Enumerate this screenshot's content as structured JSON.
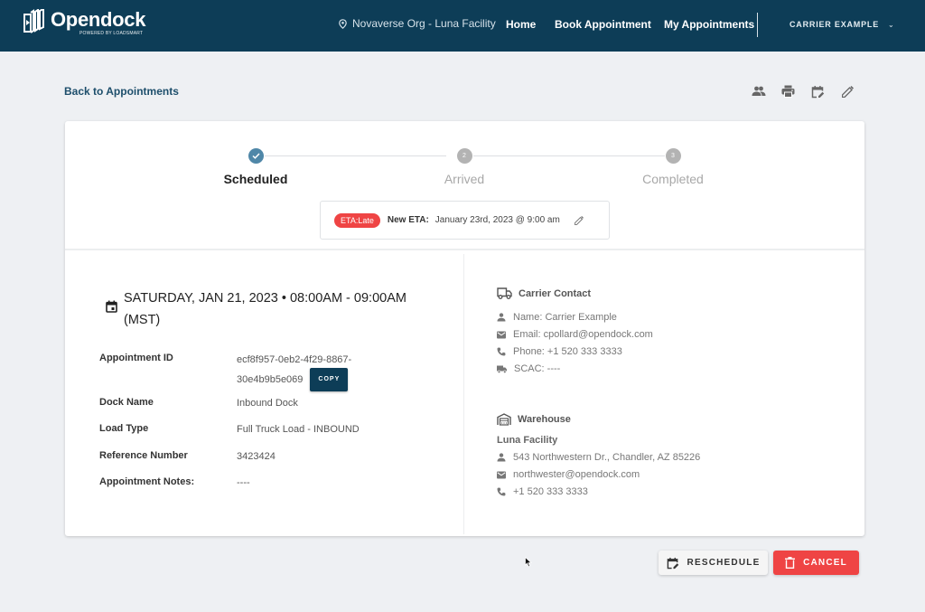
{
  "header": {
    "brand": {
      "name": "Opendock",
      "tagline": "POWERED BY LOADSMART"
    },
    "facility": {
      "icon": "location-pin-icon",
      "label": "Novaverse Org - Luna Facility"
    },
    "nav": [
      {
        "label": "Home"
      },
      {
        "label": "Book Appointment"
      },
      {
        "label": "My Appointments"
      }
    ],
    "user_menu": {
      "label": "CARRIER EXAMPLE",
      "icon": "chevron-down-icon"
    }
  },
  "page": {
    "back_link": "Back to Appointments",
    "toolbar": [
      {
        "icon": "users-icon",
        "action": "Manage users"
      },
      {
        "icon": "printer-icon",
        "action": "Print"
      },
      {
        "icon": "calendar-edit-icon",
        "action": "Reschedule"
      },
      {
        "icon": "pencil-icon",
        "action": "Edit"
      }
    ]
  },
  "stepper": {
    "steps": [
      {
        "number": "1",
        "label": "Scheduled",
        "state": "complete"
      },
      {
        "number": "2",
        "label": "Arrived",
        "state": "pending"
      },
      {
        "number": "3",
        "label": "Completed",
        "state": "pending"
      }
    ],
    "colors": {
      "complete": "#4f87a8",
      "pending": "#b3b3b3"
    }
  },
  "eta": {
    "chip": "ETA:Late",
    "label": "New ETA:",
    "value": "January 23rd, 2023 @ 9:00 am"
  },
  "appointment": {
    "date_line": "SATURDAY, JAN 21, 2023  •  08:00AM - 09:00AM (MST)",
    "details": [
      {
        "label": "Appointment ID",
        "value_line1": "ecf8f957-0eb2-4f29-8867-",
        "value_line2": "30e4b9b5e069"
      },
      {
        "label": "Dock Name",
        "value": "Inbound Dock"
      },
      {
        "label": "Load Type",
        "value": "Full Truck Load - INBOUND"
      },
      {
        "label": "Reference Number",
        "value": "3423424"
      },
      {
        "label": "Appointment Notes:",
        "value": "----"
      }
    ],
    "copy_label": "COPY"
  },
  "carrier_contact": {
    "title": "Carrier Contact",
    "lines": [
      {
        "icon": "person-icon",
        "text": "Name: Carrier Example"
      },
      {
        "icon": "email-icon",
        "text": "Email: cpollard@opendock.com"
      },
      {
        "icon": "phone-icon",
        "text": "Phone: +1 520 333 3333"
      },
      {
        "icon": "truck-fast-icon",
        "text": "SCAC: ----"
      }
    ]
  },
  "warehouse": {
    "title": "Warehouse",
    "name": "Luna Facility",
    "lines": [
      {
        "icon": "person-icon",
        "text": "543 Northwestern Dr., Chandler, AZ 85226"
      },
      {
        "icon": "email-icon",
        "text": "northwester@opendock.com"
      },
      {
        "icon": "phone-icon",
        "text": "+1 520 333 3333"
      }
    ]
  },
  "actions": {
    "reschedule": "RESCHEDULE",
    "cancel": "CANCEL"
  },
  "colors": {
    "header_bg": "#0d3d57",
    "page_bg": "#eef0f3",
    "danger": "#ef4444",
    "link": "#1d4e6b"
  }
}
